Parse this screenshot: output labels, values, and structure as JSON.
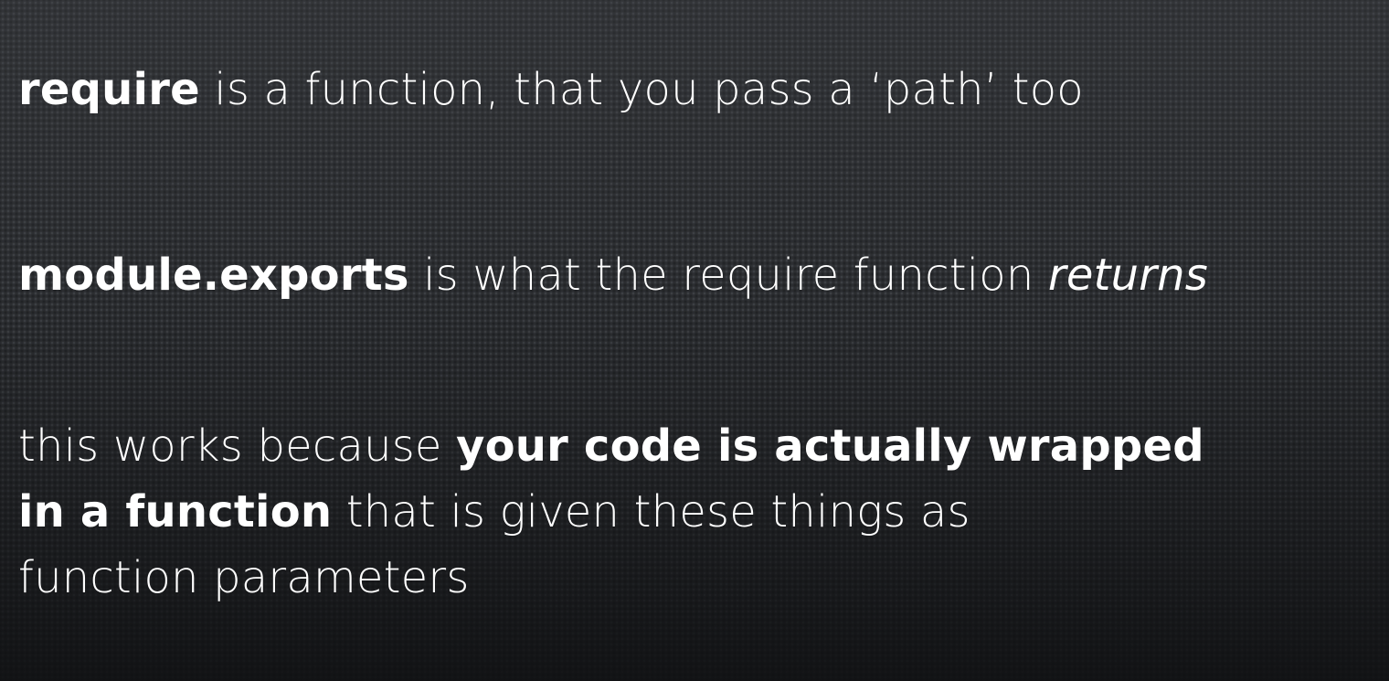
{
  "slide": {
    "statements": [
      {
        "segments": [
          {
            "text": "require",
            "style": "bold"
          },
          {
            "text": " is a function, that you pass a ‘path’ too",
            "style": "normal"
          }
        ]
      },
      {
        "segments": [
          {
            "text": "module.exports",
            "style": "bold"
          },
          {
            "text": " is what the require function ",
            "style": "normal"
          },
          {
            "text": "returns",
            "style": "italic"
          }
        ]
      },
      {
        "lines": [
          {
            "segments": [
              {
                "text": "this works because ",
                "style": "normal"
              },
              {
                "text": "your code is actually wrapped",
                "style": "bold"
              }
            ]
          },
          {
            "segments": [
              {
                "text": "in a function",
                "style": "bold"
              },
              {
                "text": " that is given these things as",
                "style": "normal"
              }
            ]
          },
          {
            "segments": [
              {
                "text": "function parameters",
                "style": "normal"
              }
            ]
          }
        ]
      }
    ]
  }
}
